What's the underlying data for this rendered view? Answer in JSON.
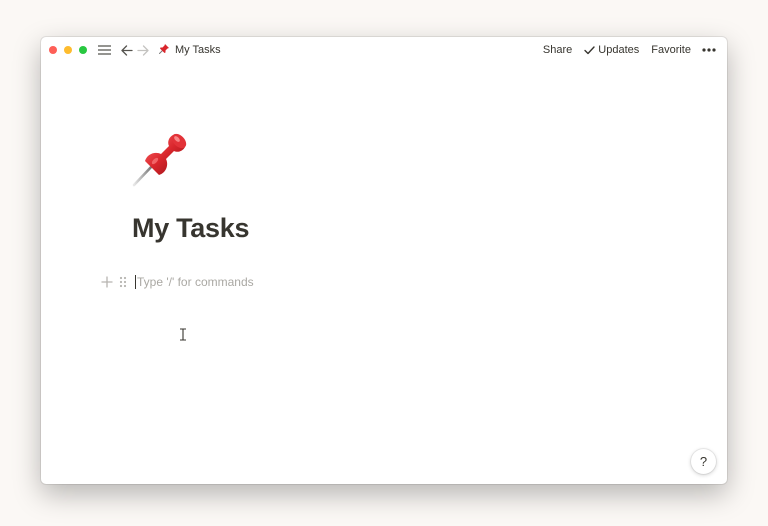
{
  "titlebar": {
    "breadcrumb_icon": "pushpin-icon",
    "breadcrumb_title": "My Tasks",
    "share_label": "Share",
    "updates_label": "Updates",
    "favorite_label": "Favorite"
  },
  "page": {
    "icon": "pushpin-icon",
    "title": "My Tasks"
  },
  "editor": {
    "placeholder": "Type '/' for commands"
  },
  "help": {
    "label": "?"
  },
  "colors": {
    "background": "#fbf8f5",
    "text": "#37352f",
    "placeholder": "#aaa8a3",
    "close": "#fe5f57",
    "minimize": "#febc2e",
    "zoom": "#28c840",
    "pin_red": "#d9262c"
  }
}
